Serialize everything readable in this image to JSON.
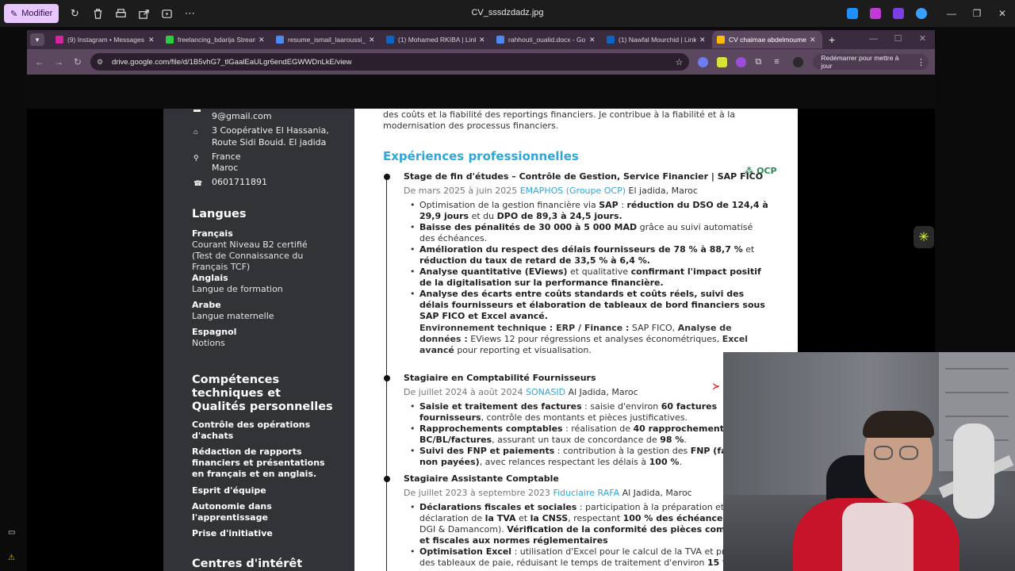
{
  "viewer": {
    "modifier_label": "Modifier",
    "file_title": "CV_sssdzdadz.jpg"
  },
  "tabs": [
    {
      "title": "(9) Instagram • Messages",
      "color": "#d6249f"
    },
    {
      "title": "freelancing_bdarija Stream",
      "color": "#2ecc40"
    },
    {
      "title": "resume_ismail_laaroussi_e",
      "color": "#4c8bf5"
    },
    {
      "title": "(1) Mohamed RKIBA | Link",
      "color": "#0a66c2"
    },
    {
      "title": "rahhouti_oualid.docx - Go",
      "color": "#4c8bf5"
    },
    {
      "title": "(1) Nawfal Mourchid | Link",
      "color": "#0a66c2"
    },
    {
      "title": "CV chaimae abdelmoume",
      "color": "#fbbc04"
    }
  ],
  "omnibox": {
    "url": "drive.google.com/file/d/1B5vhG7_tlGaalEaULgr6endEGWWDnLkE/view",
    "restart_label": "Redémarrer pour mettre à jour"
  },
  "cv": {
    "sidebar": {
      "email": "9@gmail.com",
      "address": "3 Coopérative El Hassania, Route Sidi Bouid. El jadida",
      "country_1": "France",
      "country_2": "Maroc",
      "phone": "0601711891",
      "languages_title": "Langues",
      "languages": [
        {
          "name": "Français",
          "level": "Courant Niveau B2 certifié (Test de Connaissance du Français TCF)"
        },
        {
          "name": "Anglais",
          "level": "Langue de formation"
        },
        {
          "name": "Arabe",
          "level": "Langue maternelle"
        },
        {
          "name": "Espagnol",
          "level": "Notions"
        }
      ],
      "skills_title": "Compétences techniques et Qualités personnelles",
      "skills": [
        "Contrôle des opérations d'achats",
        "Rédaction de rapports financiers et présentations en français et en anglais.",
        "Esprit d'équipe",
        "Autonomie dans l'apprentissage",
        "Prise d'initiative"
      ],
      "interests_title": "Centres d'intérêt"
    },
    "intro": "des coûts et la fiabilité des reportings financiers. Je contribue à la fiabilité et à la modernisation des processus financiers.",
    "experience_title": "Expériences professionnelles",
    "jobs": [
      {
        "title": "Stage de fin d'études – Contrôle de Gestion, Service Financier | SAP FICO",
        "dates": "De mars 2025 à juin 2025",
        "company": "EMAPHOS (Groupe OCP)",
        "location": "El jadida, Maroc",
        "logo": "OCP"
      },
      {
        "title": "Stagiaire en Comptabilité Fournisseurs",
        "dates": "De juillet 2024 à août 2024",
        "company": "SONASID",
        "location": "Al Jadida, Maroc"
      },
      {
        "title": "Stagiaire Assistante Comptable",
        "dates": "De juillet 2023 à septembre 2023",
        "company": "Fiduciaire RAFA",
        "location": "Al Jadida, Maroc"
      }
    ]
  }
}
